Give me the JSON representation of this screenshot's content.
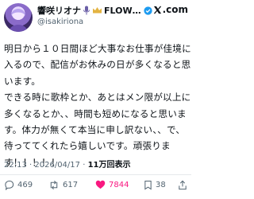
{
  "author": {
    "name": "響咲リオナ",
    "name_suffix": "FLOW…",
    "handle": "@isakiriona"
  },
  "brand": {
    "logo_text": ".com"
  },
  "tweet": {
    "text": "明日から１０日間ほど大事なお仕事が佳境に入るので、配信がお休みの日が多くなると思います。\nできる時に歌枠とか、あとはメン限が以上に多くなるとか、、時間も短めになると思います。体力が無くて本当に申し訳ない、、で、待っててくれたら嬉しいです。頑張ります！！！！！",
    "time": "22:13",
    "date": "2026/04/17",
    "views": "11万回表示"
  },
  "actions": {
    "replies": "469",
    "reposts": "617",
    "likes": "7844",
    "bookmarks": "38"
  },
  "colors": {
    "like": "#f91880",
    "verified": "#1d9bf0",
    "crown": "#e3b341"
  },
  "icons": [
    "mic-icon",
    "crown-icon",
    "verified-icon",
    "x-logo-icon",
    "reply-icon",
    "repost-icon",
    "like-icon",
    "bookmark-icon",
    "share-icon"
  ]
}
